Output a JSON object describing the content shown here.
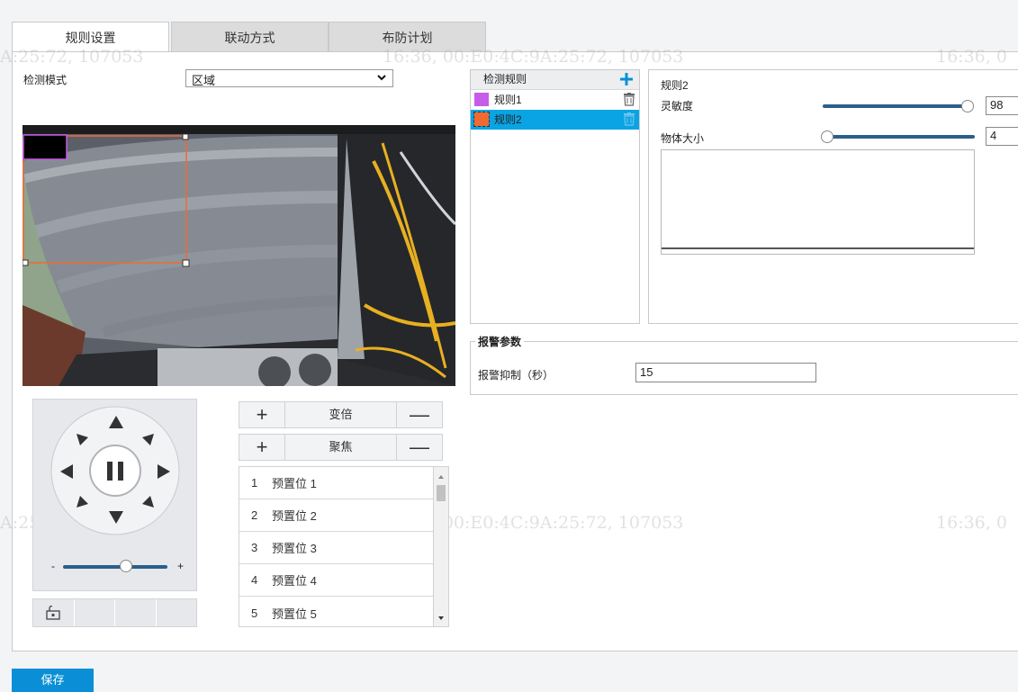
{
  "tabs": [
    {
      "label": "规则设置",
      "active": true
    },
    {
      "label": "联动方式",
      "active": false
    },
    {
      "label": "布防计划",
      "active": false
    }
  ],
  "detection_mode": {
    "label": "检测模式",
    "value": "区域"
  },
  "watermark": {
    "text_a": "A:25:72, 107053",
    "text_b": "16:36, 00:E0:4C:9A:25:72, 107053",
    "text_c": "16:36, 0"
  },
  "rule_list": {
    "header": "检测规则",
    "add_icon": "plus-icon",
    "items": [
      {
        "label": "规则1",
        "color": "#c75ce8",
        "selected": false
      },
      {
        "label": "规则2",
        "color": "#f06a32",
        "selected": true
      }
    ]
  },
  "rule_detail": {
    "title": "规则2",
    "sensitivity_label": "灵敏度",
    "sensitivity_value": "98",
    "object_size_label": "物体大小",
    "object_size_value": "4"
  },
  "alarm": {
    "legend": "报警参数",
    "suppress_label": "报警抑制（秒）",
    "suppress_value": "15"
  },
  "ptz": {
    "zoom_label": "变倍",
    "focus_label": "聚焦",
    "plus": "+",
    "minus": "—",
    "speed_minus": "-",
    "speed_plus": "+",
    "speed_level": 0.6,
    "presets": [
      {
        "num": "1",
        "name": "预置位 1"
      },
      {
        "num": "2",
        "name": "预置位 2"
      },
      {
        "num": "3",
        "name": "预置位 3"
      },
      {
        "num": "4",
        "name": "预置位 4"
      },
      {
        "num": "5",
        "name": "预置位 5"
      }
    ]
  },
  "save_label": "保存",
  "colors": {
    "accent": "#0a8fd6",
    "selected_row": "#0aa4e4",
    "rule1": "#c75ce8",
    "rule2": "#f06a32",
    "slider": "#2a5f8a"
  }
}
